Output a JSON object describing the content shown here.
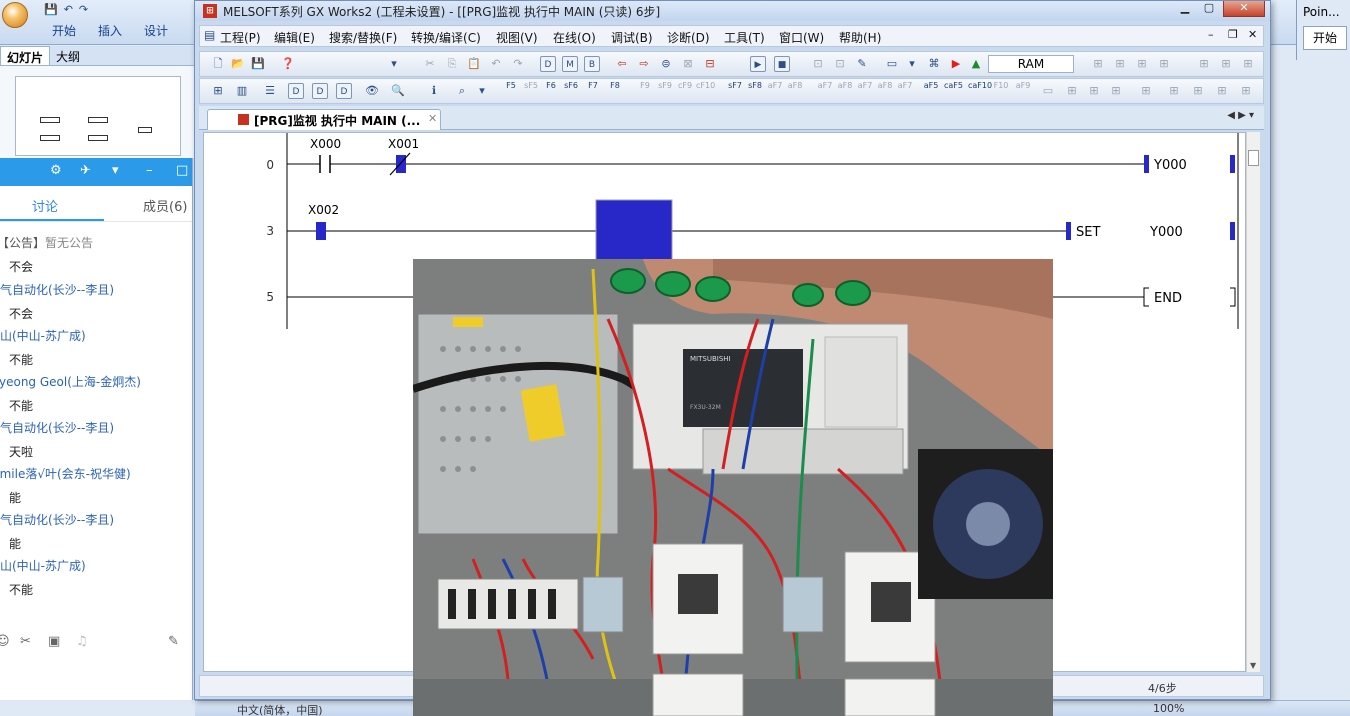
{
  "ppt": {
    "quick_access": [
      "💾",
      "↶",
      "↷"
    ],
    "tabs": [
      "开始",
      "插入",
      "设计"
    ],
    "side_tabs": [
      "幻灯片",
      "大纲"
    ],
    "status": {
      "language": "中文(简体，中国)",
      "zoom": "100%"
    },
    "side_window": {
      "title": "Poin...",
      "button": "开始"
    }
  },
  "chat": {
    "tabs": {
      "discussion": "讨论",
      "members": "成员(6)"
    },
    "messages": [
      {
        "name": "【公告】",
        "name2": "暂无公告",
        "text": "不会"
      },
      {
        "name": "电气自动化(长沙--李且)",
        "text": "不会"
      },
      {
        "name": "佛山(中山-苏广成)",
        "text": "不能"
      },
      {
        "name": "Kyeong Geol(上海-金炯杰)",
        "text": "不能"
      },
      {
        "name": "电气自动化(长沙--李且)",
        "text": "天啦"
      },
      {
        "name": "Smile落√叶(会东-祝华健)",
        "text": "能"
      },
      {
        "name": "电气自动化(长沙--李且)",
        "text": "能"
      },
      {
        "name": "佛山(中山-苏广成)",
        "text": "不能"
      }
    ]
  },
  "gx": {
    "title": "MELSOFT系列 GX Works2 (工程未设置) - [[PRG]监视 执行中 MAIN (只读) 6步]",
    "menu": [
      "工程(P)",
      "编辑(E)",
      "搜索/替换(F)",
      "转换/编译(C)",
      "视图(V)",
      "在线(O)",
      "调试(B)",
      "诊断(D)",
      "工具(T)",
      "窗口(W)",
      "帮助(H)"
    ],
    "ram_label": "RAM",
    "fkeys": [
      "F5",
      "sF5",
      "F6",
      "sF6",
      "F7",
      "F8",
      "F9",
      "sF9",
      "cF9",
      "cF10",
      "sF7",
      "sF8",
      "aF7",
      "aF8",
      "aF5",
      "caF5",
      "caF10",
      "F10",
      "aF9"
    ],
    "doc_tab": "[PRG]监视 执行中 MAIN (...",
    "status_steps": "4/6步"
  },
  "ladder": {
    "rungs": [
      {
        "step": "0",
        "contacts": [
          {
            "label": "X000",
            "type": "NO",
            "active": false
          },
          {
            "label": "X001",
            "type": "NC",
            "active": true
          }
        ],
        "coil": {
          "label": "Y000",
          "type": "OUT",
          "active": true
        }
      },
      {
        "step": "3",
        "contacts": [
          {
            "label": "X002",
            "type": "NO",
            "active": true
          }
        ],
        "coil": {
          "label": "Y000",
          "type": "SET",
          "instruction": "SET",
          "active": true
        }
      },
      {
        "step": "5",
        "contacts": [],
        "coil": {
          "label": "END",
          "type": "END",
          "active": false
        }
      }
    ],
    "colors": {
      "active": "#2828c8",
      "line": "#000000"
    }
  }
}
